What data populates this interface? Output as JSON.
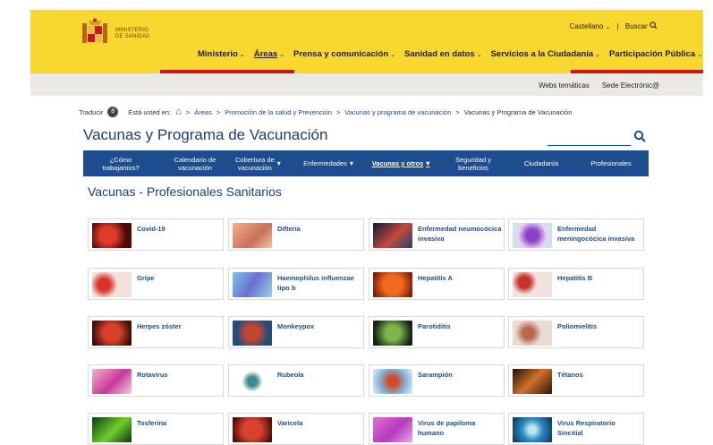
{
  "header": {
    "ministry_line1": "MINISTERIO",
    "ministry_line2": "DE SANIDAD",
    "language": "Castellano",
    "search_label": "Buscar",
    "nav": [
      {
        "label": "Ministerio"
      },
      {
        "label": "Áreas"
      },
      {
        "label": "Prensa y comunicación"
      },
      {
        "label": "Sanidad en datos"
      },
      {
        "label": "Servicios a la Ciudadanía"
      },
      {
        "label": "Participación Pública"
      }
    ]
  },
  "utility_links": [
    "Webs temáticas",
    "Sede Electrónic@"
  ],
  "breadcrumb": {
    "translate": "Traducir",
    "prefix": "Está usted en:",
    "items": [
      "Áreas",
      "Promoción de la salud y Prevención",
      "Vacunas y programa de vacunación",
      "Vacunas y Programa de Vacunación"
    ]
  },
  "page": {
    "title": "Vacunas y Programa de Vacunación",
    "section_title": "Vacunas - Profesionales Sanitarios",
    "search_placeholder": ""
  },
  "subnav": [
    {
      "line1": "¿Cómo",
      "line2": "trabajamos?"
    },
    {
      "line1": "Calendario de",
      "line2": "vacunación"
    },
    {
      "line1": "Cobertura de",
      "line2": "vacunación"
    },
    {
      "line1": "Enfermedades",
      "line2": ""
    },
    {
      "line1": "Vacunas y otros",
      "line2": ""
    },
    {
      "line1": "Seguridad y",
      "line2": "beneficios"
    },
    {
      "line1": "Ciudadanía",
      "line2": ""
    },
    {
      "line1": "Profesionales",
      "line2": ""
    }
  ],
  "cards": [
    {
      "label": "Covid-19"
    },
    {
      "label": "Difteria"
    },
    {
      "label": "Enfermedad neumocócica invasiva"
    },
    {
      "label": "Enfermedad meningocócica invasiva"
    },
    {
      "label": "Gripe"
    },
    {
      "label": "Haemophilus influenzae tipo b"
    },
    {
      "label": "Hepatitis A"
    },
    {
      "label": "Hepatitis B"
    },
    {
      "label": "Herpes zóster"
    },
    {
      "label": "Monkeypox"
    },
    {
      "label": "Parotiditis"
    },
    {
      "label": "Poliomielitis"
    },
    {
      "label": "Rotavirus"
    },
    {
      "label": "Rubeola"
    },
    {
      "label": "Sarampión"
    },
    {
      "label": "Tétanos"
    },
    {
      "label": "Tosferina"
    },
    {
      "label": "Varicela"
    },
    {
      "label": "Virus de papiloma humano"
    },
    {
      "label": "Virus Respiratorio Sincitial"
    }
  ],
  "colors": {
    "header_yellow": "#f8d72f",
    "accent_red": "#c8191c",
    "nav_blue": "#1d4d8c",
    "title_blue": "#1c3f74"
  }
}
